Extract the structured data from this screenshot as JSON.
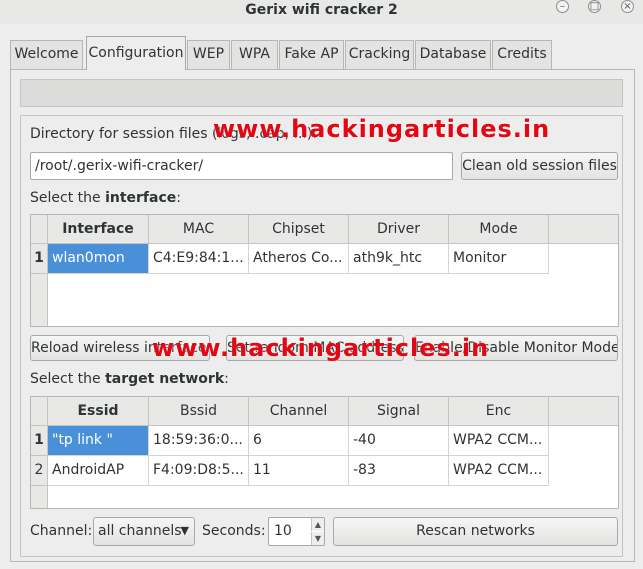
{
  "window": {
    "title": "Gerix wifi cracker 2",
    "controls": [
      "minimize-icon",
      "maximize-icon",
      "close-icon"
    ]
  },
  "tabs": [
    {
      "label": "Welcome"
    },
    {
      "label": "Configuration"
    },
    {
      "label": "WEP"
    },
    {
      "label": "WPA"
    },
    {
      "label": "Fake AP"
    },
    {
      "label": "Cracking"
    },
    {
      "label": "Database"
    },
    {
      "label": "Credits"
    }
  ],
  "active_tab": "Configuration",
  "session": {
    "label": "Directory for session files (logs, .cap, ...):",
    "path": "/root/.gerix-wifi-cracker/",
    "clean_button": "Clean old session files"
  },
  "interface": {
    "label_prefix": "Select the ",
    "label_bold": "interface",
    "label_suffix": ":",
    "columns": [
      "Interface",
      "MAC",
      "Chipset",
      "Driver",
      "Mode"
    ],
    "rows": [
      {
        "num": "1",
        "cells": [
          "wlan0mon",
          "C4:E9:84:1...",
          "Atheros Co...",
          "ath9k_htc",
          "Monitor"
        ]
      }
    ],
    "buttons": {
      "reload": "Reload wireless interfaces",
      "set_mac": "Set random MAC address",
      "monitor": "Enable/Disable Monitor Mode"
    }
  },
  "network": {
    "label_prefix": "Select the ",
    "label_bold": "target network",
    "label_suffix": ":",
    "columns": [
      "Essid",
      "Bssid",
      "Channel",
      "Signal",
      "Enc"
    ],
    "rows": [
      {
        "num": "1",
        "cells": [
          "\"tp link \"",
          "18:59:36:0...",
          "6",
          "-40",
          "WPA2 CCM..."
        ]
      },
      {
        "num": "2",
        "cells": [
          "AndroidAP",
          "F4:09:D8:5...",
          "11",
          "-83",
          "WPA2 CCM..."
        ]
      }
    ]
  },
  "scan": {
    "channel_label": "Channel:",
    "channel_value": "all channels",
    "seconds_label": "Seconds:",
    "seconds_value": "10",
    "rescan_button": "Rescan networks"
  },
  "watermark": "www.hackingarticles.in",
  "colors": {
    "selection": "#4a90d9",
    "watermark": "#e30613"
  }
}
